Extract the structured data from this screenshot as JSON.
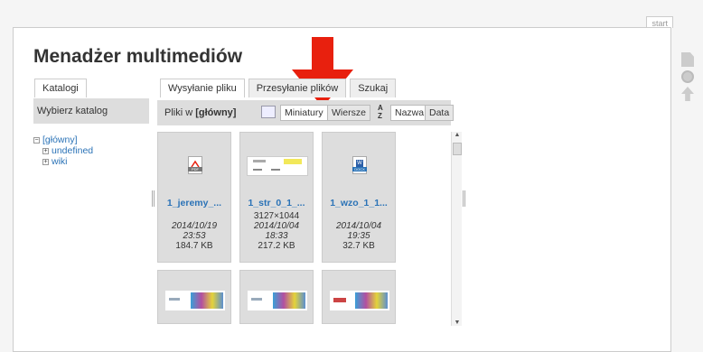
{
  "page": {
    "start_tab": "start",
    "title": "Menadżer multimediów"
  },
  "left": {
    "tab": "Katalogi",
    "heading": "Wybierz katalog",
    "tree": {
      "root": "[główny]",
      "children": [
        "undefined",
        "wiki"
      ]
    }
  },
  "right": {
    "tabs": [
      "Wysyłanie pliku",
      "Przesyłanie plików",
      "Szukaj"
    ],
    "files_in_label": "Pliki w",
    "files_in_value": "[główny]",
    "view_buttons": [
      "Miniatury",
      "Wiersze"
    ],
    "sort_buttons": [
      "Nazwa",
      "Data"
    ],
    "files": [
      {
        "name": "1_jeremy_...",
        "dims": "",
        "date": "2014/10/19",
        "time": "23:53",
        "size": "184.7 KB",
        "icon": "pdf-icon",
        "badge": "PDF"
      },
      {
        "name": "1_str_0_1_...",
        "dims": "3127×1044",
        "date": "2014/10/04",
        "time": "18:33",
        "size": "217.2 KB",
        "icon": "image-thumbnail",
        "badge": ""
      },
      {
        "name": "1_wzo_1_1...",
        "dims": "",
        "date": "2014/10/04",
        "time": "19:35",
        "size": "32.7 KB",
        "icon": "docx-icon",
        "badge": "DOCX"
      }
    ],
    "second_row_thumbnails": [
      "photo-thumbnail",
      "photo-thumbnail",
      "photo-thumbnail"
    ]
  },
  "colors": {
    "link": "#2b73b7",
    "arrow": "#e8200e",
    "panel": "#dddddd"
  }
}
